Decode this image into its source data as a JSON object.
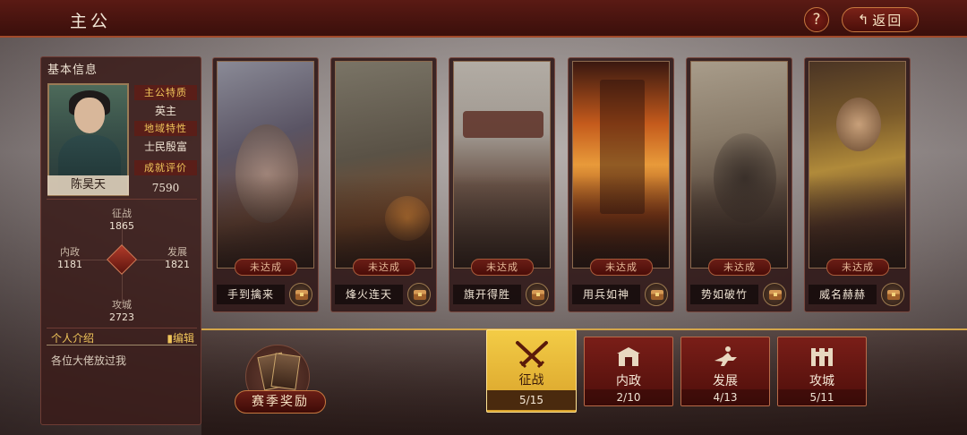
{
  "header": {
    "title": "主公",
    "help_label": "?",
    "back_label": "返回",
    "back_icon": "back-arrow-icon"
  },
  "profile": {
    "section_title": "基本信息",
    "name": "陈昊天",
    "traits": [
      {
        "label": "主公特质",
        "value": "英主"
      },
      {
        "label": "地域特性",
        "value": "士民殷富"
      },
      {
        "label": "成就评价",
        "value": "7590"
      }
    ],
    "stats": {
      "zhengzhan": {
        "label": "征战",
        "value": "1865"
      },
      "neizheng": {
        "label": "内政",
        "value": "1181"
      },
      "fazhan": {
        "label": "发展",
        "value": "1821"
      },
      "gongcheng": {
        "label": "攻城",
        "value": "2723"
      }
    },
    "intro_label": "个人介绍",
    "edit_label": "编辑",
    "intro_text": "各位大佬放过我"
  },
  "achievements": [
    {
      "status": "未达成",
      "name": "手到擒来"
    },
    {
      "status": "未达成",
      "name": "烽火连天"
    },
    {
      "status": "未达成",
      "name": "旗开得胜"
    },
    {
      "status": "未达成",
      "name": "用兵如神"
    },
    {
      "status": "未达成",
      "name": "势如破竹"
    },
    {
      "status": "未达成",
      "name": "威名赫赫"
    }
  ],
  "season_reward_label": "赛季奖励",
  "categories": [
    {
      "label": "征战",
      "count": "5/15",
      "icon": "crossed-swords-icon",
      "active": true
    },
    {
      "label": "内政",
      "count": "2/10",
      "icon": "city-gate-icon",
      "active": false
    },
    {
      "label": "发展",
      "count": "4/13",
      "icon": "horseman-icon",
      "active": false
    },
    {
      "label": "攻城",
      "count": "5/11",
      "icon": "fortress-icon",
      "active": false
    }
  ]
}
